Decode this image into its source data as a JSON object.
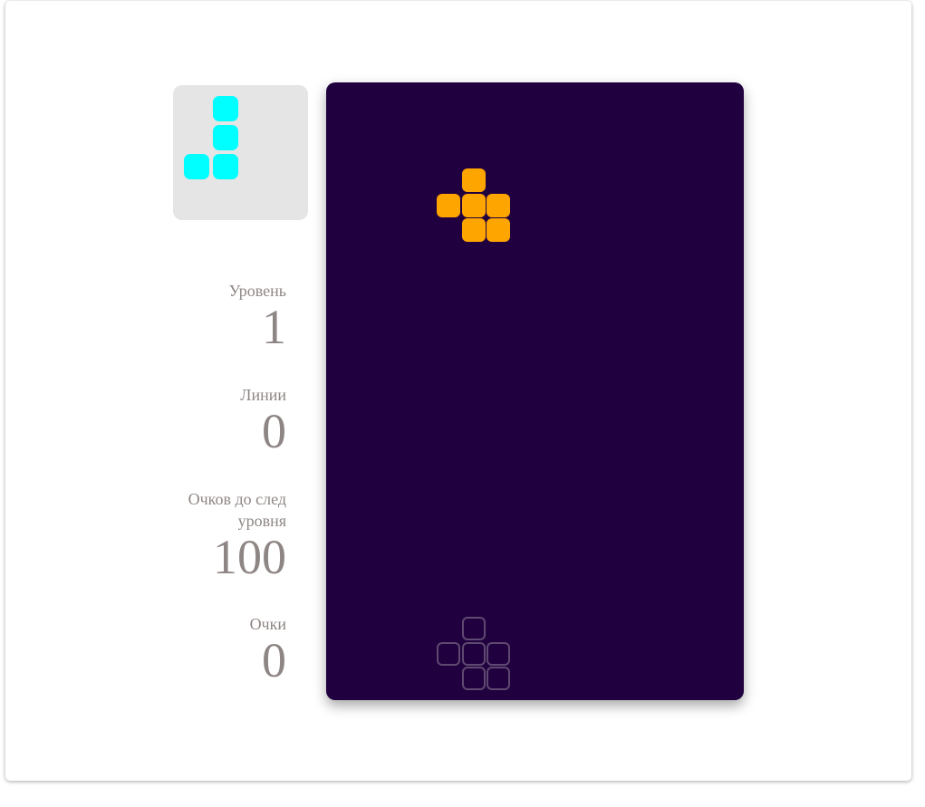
{
  "colors": {
    "next_piece": "#00ffff",
    "active_piece": "#ffa500",
    "ghost_outline": "#5e4a70",
    "board_bg": "#21003f",
    "next_bg": "#e5e5e5",
    "stat_text": "#8e8684"
  },
  "next_piece": {
    "name": "J",
    "cells": [
      [
        1,
        0
      ],
      [
        1,
        1
      ],
      [
        0,
        2
      ],
      [
        1,
        2
      ]
    ]
  },
  "active_piece": {
    "cells": [
      [
        1,
        0
      ],
      [
        0,
        1
      ],
      [
        1,
        1
      ],
      [
        2,
        1
      ],
      [
        1,
        2
      ],
      [
        2,
        2
      ]
    ]
  },
  "ghost_piece": {
    "cells": [
      [
        1,
        0
      ],
      [
        0,
        1
      ],
      [
        1,
        1
      ],
      [
        2,
        1
      ],
      [
        1,
        2
      ],
      [
        2,
        2
      ]
    ]
  },
  "stats": {
    "level": {
      "label": "Уровень",
      "value": "1"
    },
    "lines": {
      "label": "Линии",
      "value": "0"
    },
    "to_next": {
      "label": "Очков до след уровня",
      "value": "100"
    },
    "score": {
      "label": "Очки",
      "value": "0"
    }
  }
}
